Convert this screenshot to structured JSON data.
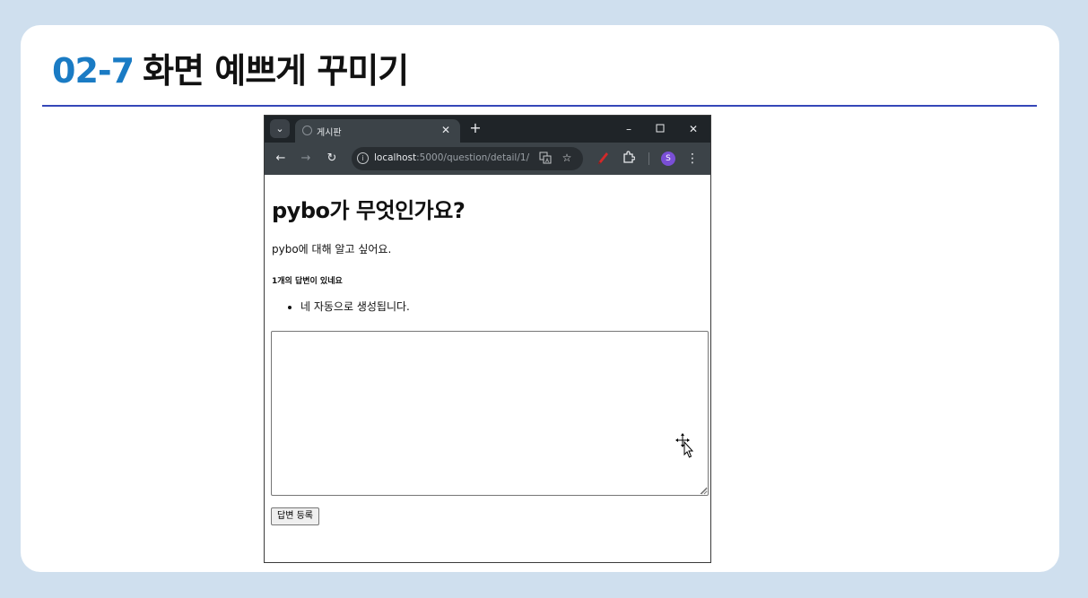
{
  "slide": {
    "title_number": "02-7",
    "title_text": "화면 예쁘게 꾸미기",
    "accent_color": "#1a7bc4",
    "rule_color": "#3547b8"
  },
  "browser": {
    "tab_menu_icon": "chevron-down-icon",
    "tab_title": "게시판",
    "tab_close_icon": "close-icon",
    "new_tab_icon": "plus-icon",
    "window_controls": {
      "minimize": "–",
      "maximize": "☐",
      "close": "✕"
    },
    "toolbar": {
      "back_icon": "arrow-left-icon",
      "forward_icon": "arrow-right-icon",
      "reload_icon": "reload-icon",
      "url_host": "localhost",
      "url_path": ":5000/question/detail/1/",
      "profile_initial": "S",
      "profile_color": "#7a4fd6"
    }
  },
  "page": {
    "subject": "pybo가 무엇인가요?",
    "content": "pybo에 대해 알고 싶어요.",
    "answer_count": "1개의 답변이 있네요",
    "answers": [
      "네 자동으로 생성됩니다."
    ],
    "textarea_value": "",
    "submit_label": "답변 등록"
  }
}
